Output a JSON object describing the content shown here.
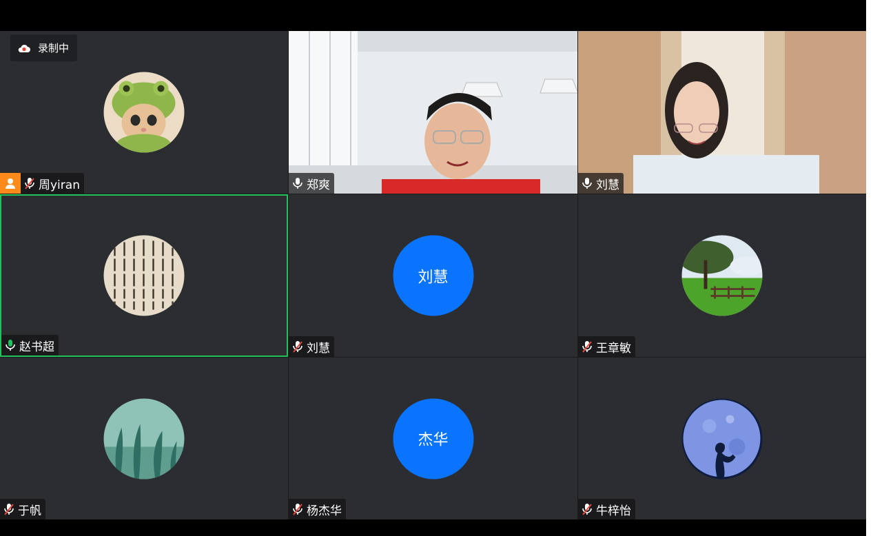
{
  "recording": {
    "label": "录制中"
  },
  "participants": [
    {
      "name": "周yiran",
      "avatar": "cat-avatar",
      "muted": true,
      "host": true
    },
    {
      "name": "郑爽",
      "video": "office-video",
      "muted": false
    },
    {
      "name": "刘慧",
      "video": "bookshelf-video",
      "muted": false
    },
    {
      "name": "赵书超",
      "avatar": "calligraphy-avatar",
      "muted": false,
      "speaking": true
    },
    {
      "name": "刘慧",
      "initials": "刘慧",
      "muted": true
    },
    {
      "name": "王章敏",
      "avatar": "landscape-avatar",
      "muted": true
    },
    {
      "name": "于帆",
      "avatar": "seaweed-avatar",
      "muted": true
    },
    {
      "name": "杨杰华",
      "initials": "杰华",
      "muted": true
    },
    {
      "name": "牛梓怡",
      "avatar": "moon-avatar",
      "muted": true
    }
  ],
  "colors": {
    "tile_bg": "#2b2d31",
    "initials_bg": "#0a74ff",
    "active_border": "#21c25e",
    "host_badge": "#ff8a1c"
  }
}
